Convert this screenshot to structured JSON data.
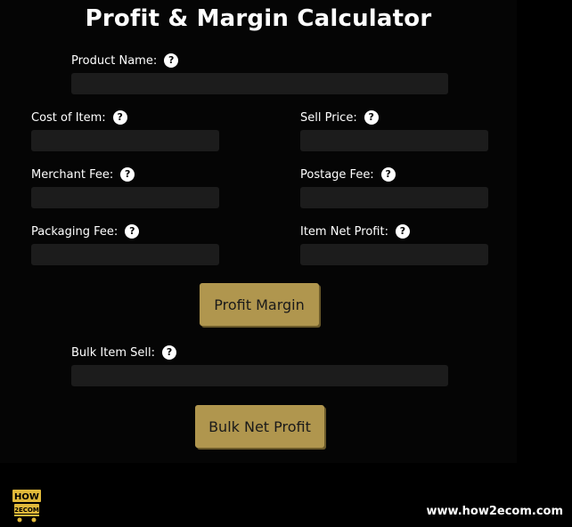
{
  "title": "Profit & Margin Calculator",
  "help_glyph": "?",
  "fields": {
    "product_name": {
      "label": "Product Name:",
      "value": ""
    },
    "cost_of_item": {
      "label": "Cost of Item:",
      "value": ""
    },
    "sell_price": {
      "label": "Sell Price:",
      "value": ""
    },
    "merchant_fee": {
      "label": "Merchant Fee:",
      "value": ""
    },
    "postage_fee": {
      "label": "Postage Fee:",
      "value": ""
    },
    "packaging_fee": {
      "label": "Packaging Fee:",
      "value": ""
    },
    "item_net_profit": {
      "label": "Item Net Profit:",
      "value": ""
    },
    "bulk_item_sell": {
      "label": "Bulk Item Sell:",
      "value": ""
    }
  },
  "buttons": {
    "profit_margin": "Profit Margin",
    "bulk_net_profit": "Bulk Net Profit"
  },
  "footer": {
    "logo_text_top": "HOW",
    "logo_text_bottom": "2ECOM",
    "site": "www.how2ecom.com"
  },
  "colors": {
    "background": "#000000",
    "field": "#1c1c1c",
    "button": "#b0964e",
    "logo": "#e0b93a"
  },
  "icons": [
    "help-icon",
    "cart-logo-icon"
  ]
}
